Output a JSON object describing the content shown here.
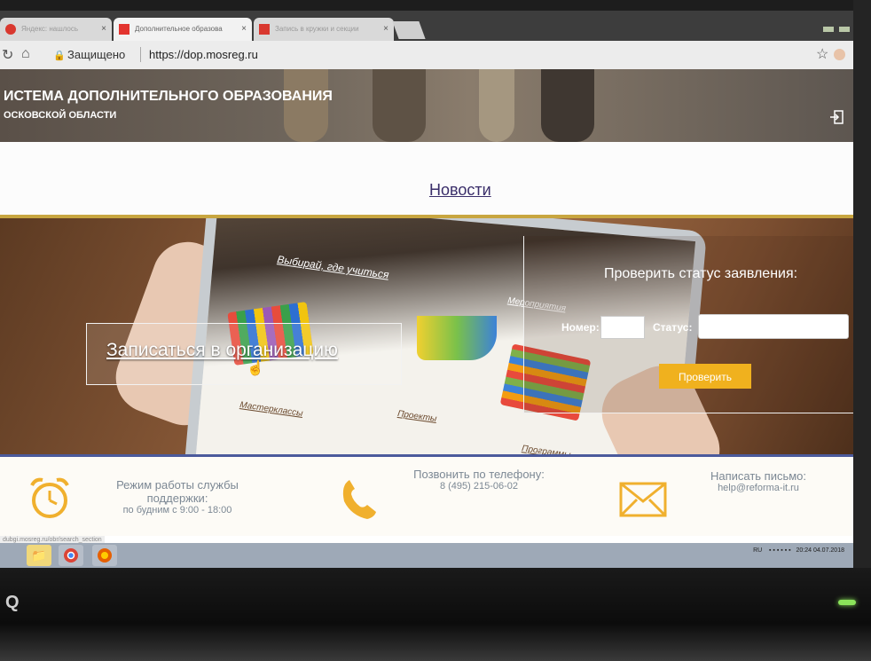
{
  "browser": {
    "tabs": [
      {
        "label": "Яндекс: нашлось",
        "active": false
      },
      {
        "label": "Дополнительное образова",
        "active": true
      },
      {
        "label": "Запись в кружки и секции",
        "active": false
      }
    ],
    "address": {
      "secure_label": "Защищено",
      "url": "https://dop.mosreg.ru"
    }
  },
  "header": {
    "title": "ИСТЕМА ДОПОЛНИТЕЛЬНОГО ОБРАЗОВАНИЯ",
    "subtitle": "ОСКОВСКОЙ ОБЛАСТИ"
  },
  "nav": {
    "news_label": "Новости"
  },
  "banner": {
    "enroll_label": "Записаться в организацию",
    "tablet_menu": [
      "Выбирай, где учиться",
      "Мероприятия",
      "Мастерклассы",
      "Проекты",
      "Программы"
    ]
  },
  "status_check": {
    "title": "Проверить статус заявления:",
    "number_label": "Номер:",
    "number_value": "",
    "status_label": "Статус:",
    "status_value": "",
    "button_label": "Проверить"
  },
  "footer": {
    "support": {
      "title": "Режим работы службы поддержки:",
      "hours": "по будним с 9:00 - 18:00"
    },
    "phone": {
      "title": "Позвонить по телефону:",
      "number": "8 (495) 215-06-02"
    },
    "mail": {
      "title": "Написать письмо:",
      "address": "help@reforma-it.ru"
    }
  },
  "status_bar_url": "dubgi.mosreg.ru/obr/search_section",
  "taskbar": {
    "language": "RU",
    "time": "20:24",
    "date": "04.07.2018"
  },
  "colors": {
    "accent": "#f0b11e",
    "footer_border": "#4b5a9c",
    "news_link": "#3a2e6a"
  },
  "monitor_brand": "BenQ"
}
